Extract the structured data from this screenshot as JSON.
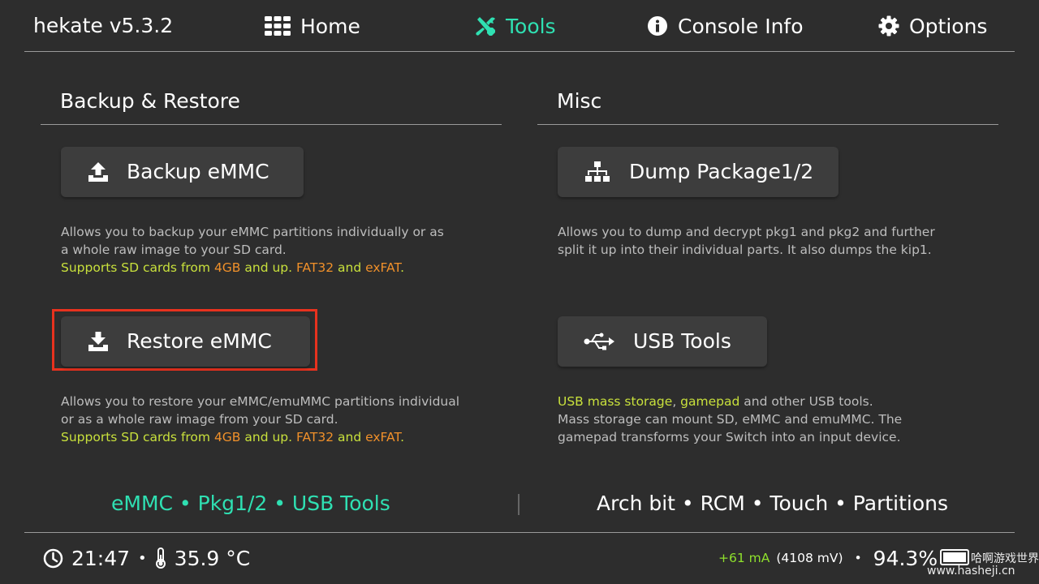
{
  "header": {
    "app_title": "hekate v5.3.2",
    "tabs": [
      {
        "label": "Home",
        "icon": "grid-icon",
        "active": false
      },
      {
        "label": "Tools",
        "icon": "tools-icon",
        "active": true
      },
      {
        "label": "Console Info",
        "icon": "info-icon",
        "active": false
      },
      {
        "label": "Options",
        "icon": "gear-icon",
        "active": false
      }
    ]
  },
  "backup_restore": {
    "title": "Backup & Restore",
    "backup_button": "Backup eMMC",
    "backup_desc": {
      "line1": "Allows you to backup your eMMC partitions individually or as",
      "line2": "a whole raw image to your SD card.",
      "line3": {
        "t1": "Supports SD cards from ",
        "t2": "4GB",
        "t3": " and up. ",
        "t4": "FAT32",
        "t5": " and ",
        "t6": "exFAT",
        "t7": "."
      }
    },
    "restore_button": "Restore eMMC",
    "restore_desc": {
      "line1": "Allows you to restore your eMMC/emuMMC partitions individual",
      "line2": "or as a whole raw image from your SD card.",
      "line3": {
        "t1": "Supports SD cards from ",
        "t2": "4GB",
        "t3": " and up. ",
        "t4": "FAT32",
        "t5": " and ",
        "t6": "exFAT",
        "t7": "."
      }
    }
  },
  "misc": {
    "title": "Misc",
    "dump_button": "Dump Package1/2",
    "dump_desc": {
      "line1": "Allows you to dump and decrypt pkg1 and pkg2 and further",
      "line2": "split it up into their individual parts. It also dumps the kip1."
    },
    "usb_button": "USB Tools",
    "usb_desc": {
      "line1": {
        "t1": "USB mass storage",
        "t2": ", ",
        "t3": "gamepad",
        "t4": " and other USB tools."
      },
      "line2": "Mass storage can mount SD, eMMC and emuMMC. The",
      "line3": "gamepad transforms your Switch into an input device."
    }
  },
  "quick_links": {
    "left": "eMMC • Pkg1/2 • USB Tools",
    "right": "Arch bit • RCM • Touch • Partitions"
  },
  "status_bar": {
    "time": "21:47",
    "separator": "•",
    "temperature": "35.9 °C",
    "current": "+61 mA",
    "voltage": "(4108 mV)",
    "battery_sep": "•",
    "battery": "94.3%",
    "watermark_top": "哈啊游戏世界",
    "watermark_bottom": "www.hasheji.cn"
  },
  "colors": {
    "accent": "#2fe0b2",
    "background": "#2d2d2d",
    "button": "#3d3d3d",
    "yellow": "#c8e03c",
    "orange": "#f0902a",
    "highlight": "#e8321e"
  }
}
